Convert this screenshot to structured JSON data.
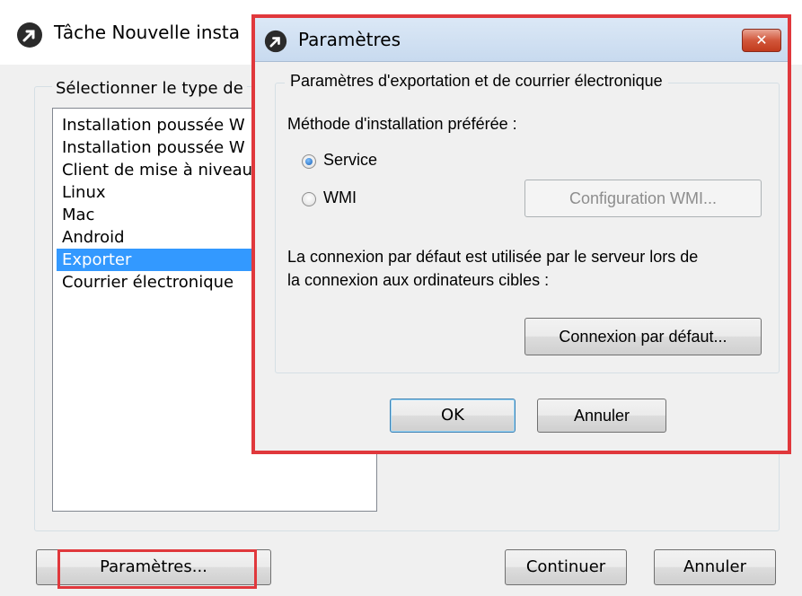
{
  "back_window": {
    "title": "Tâche Nouvelle insta",
    "group_label": "Sélectionner le type de",
    "list_items": [
      "Installation poussée W",
      "Installation poussée W",
      "Client de mise à niveau",
      "Linux",
      "Mac",
      "Android",
      "Exporter",
      "Courrier électronique"
    ],
    "selected_item": "Exporter",
    "buttons": {
      "parametres": "Paramètres...",
      "continuer": "Continuer",
      "annuler": "Annuler"
    }
  },
  "dialog": {
    "title": "Paramètres",
    "close_glyph": "✕",
    "group_label": "Paramètres d'exportation et de courrier électronique",
    "method_label": "Méthode d'installation préférée :",
    "radios": {
      "service": "Service",
      "wmi": "WMI",
      "selected": "service"
    },
    "wmi_config_button": "Configuration WMI...",
    "connection_text_line1": "La connexion par défaut est utilisée par le serveur lors de",
    "connection_text_line2": "la connexion aux ordinateurs cibles :",
    "default_connection_button": "Connexion par défaut...",
    "ok_button": "OK",
    "cancel_button": "Annuler"
  },
  "colors": {
    "highlight": "#e0383c",
    "selection": "#3399ff",
    "dialog_titlebar": "#c8daef",
    "close_button": "#d2573b"
  },
  "icons": {
    "app_icon": "arrow-up-right-circle-icon",
    "close": "close-icon"
  }
}
